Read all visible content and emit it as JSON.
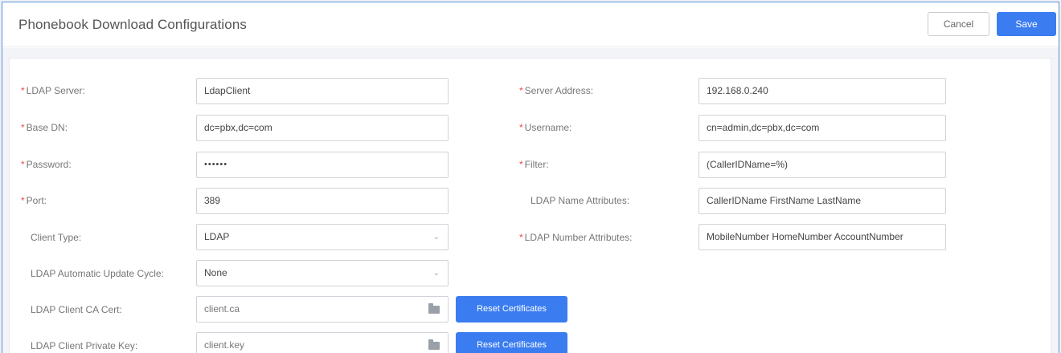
{
  "header": {
    "title": "Phonebook Download Configurations",
    "cancel_label": "Cancel",
    "save_label": "Save"
  },
  "required_mark": "*",
  "left_fields": [
    {
      "label": "LDAP Server:",
      "value": "LdapClient",
      "required": true,
      "type": "text"
    },
    {
      "label": "Base DN:",
      "value": "dc=pbx,dc=com",
      "required": true,
      "type": "text"
    },
    {
      "label": "Password:",
      "value": "••••••",
      "required": true,
      "type": "password"
    },
    {
      "label": "Port:",
      "value": "389",
      "required": true,
      "type": "text"
    },
    {
      "label": "Client Type:",
      "value": "LDAP",
      "required": false,
      "type": "select"
    },
    {
      "label": "LDAP Automatic Update Cycle:",
      "value": "None",
      "required": false,
      "type": "select"
    },
    {
      "label": "LDAP Client CA Cert:",
      "value": "client.ca",
      "required": false,
      "type": "file",
      "button": "Reset Certificates"
    },
    {
      "label": "LDAP Client Private Key:",
      "value": "client.key",
      "required": false,
      "type": "file",
      "button": "Reset Certificates"
    }
  ],
  "right_fields": [
    {
      "label": "Server Address:",
      "value": "192.168.0.240",
      "required": true
    },
    {
      "label": "Username:",
      "value": "cn=admin,dc=pbx,dc=com",
      "required": true
    },
    {
      "label": "Filter:",
      "value": "(CallerIDName=%)",
      "required": true
    },
    {
      "label": "LDAP Name Attributes:",
      "value": "CallerIDName FirstName LastName",
      "required": false
    },
    {
      "label": "LDAP Number Attributes:",
      "value": "MobileNumber HomeNumber AccountNumber",
      "required": true
    }
  ],
  "icons": {
    "select_arrow": "chevron-down-icon",
    "file_browse": "folder-icon"
  },
  "colors": {
    "accent": "#3b7df0",
    "required": "#f04a3c",
    "border": "#5b8fd8"
  }
}
